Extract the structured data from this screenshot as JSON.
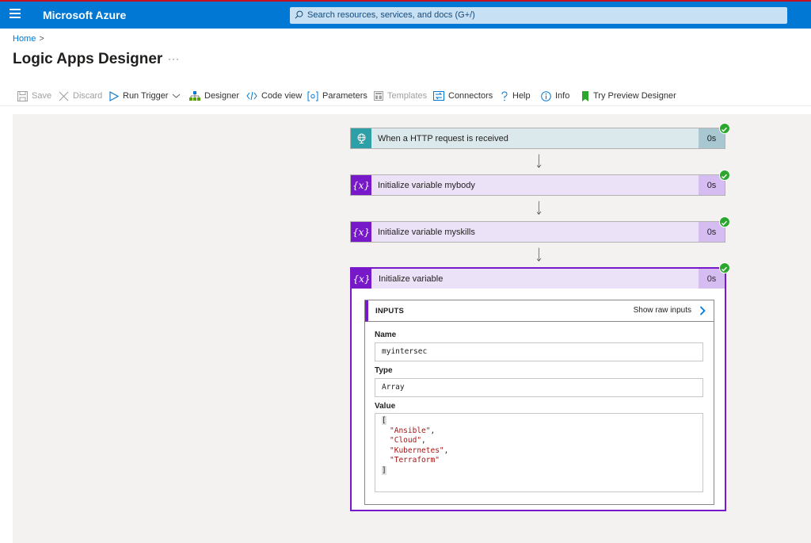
{
  "topbar": {
    "brand": "Microsoft Azure",
    "search_placeholder": "Search resources, services, and docs (G+/)",
    "accent": "#0078d4"
  },
  "breadcrumb": {
    "home": "Home",
    "separator": ">"
  },
  "page": {
    "title": "Logic Apps Designer",
    "more": "···"
  },
  "toolbar": {
    "save": "Save",
    "discard": "Discard",
    "run_trigger": "Run Trigger",
    "designer": "Designer",
    "code_view": "Code view",
    "parameters": "Parameters",
    "templates": "Templates",
    "connectors": "Connectors",
    "help": "Help",
    "info": "Info",
    "try_preview": "Try Preview Designer"
  },
  "steps": [
    {
      "label": "When a HTTP request is received",
      "duration": "0s",
      "icon": "globe-icon",
      "status": "succeeded"
    },
    {
      "label": "Initialize variable mybody",
      "duration": "0s",
      "icon": "{x}",
      "status": "succeeded"
    },
    {
      "label": "Initialize variable myskills",
      "duration": "0s",
      "icon": "{x}",
      "status": "succeeded"
    },
    {
      "label": "Initialize variable",
      "duration": "0s",
      "icon": "{x}",
      "status": "succeeded"
    }
  ],
  "inputs": {
    "header": "INPUTS",
    "show_raw": "Show raw inputs",
    "name_label": "Name",
    "name_value": "myintersec",
    "type_label": "Type",
    "type_value": "Array",
    "value_label": "Value",
    "open_bracket": "[",
    "close_bracket": "]",
    "items": [
      "\"Ansible\"",
      "\"Cloud\"",
      "\"Kubernetes\"",
      "\"Terraform\""
    ]
  }
}
